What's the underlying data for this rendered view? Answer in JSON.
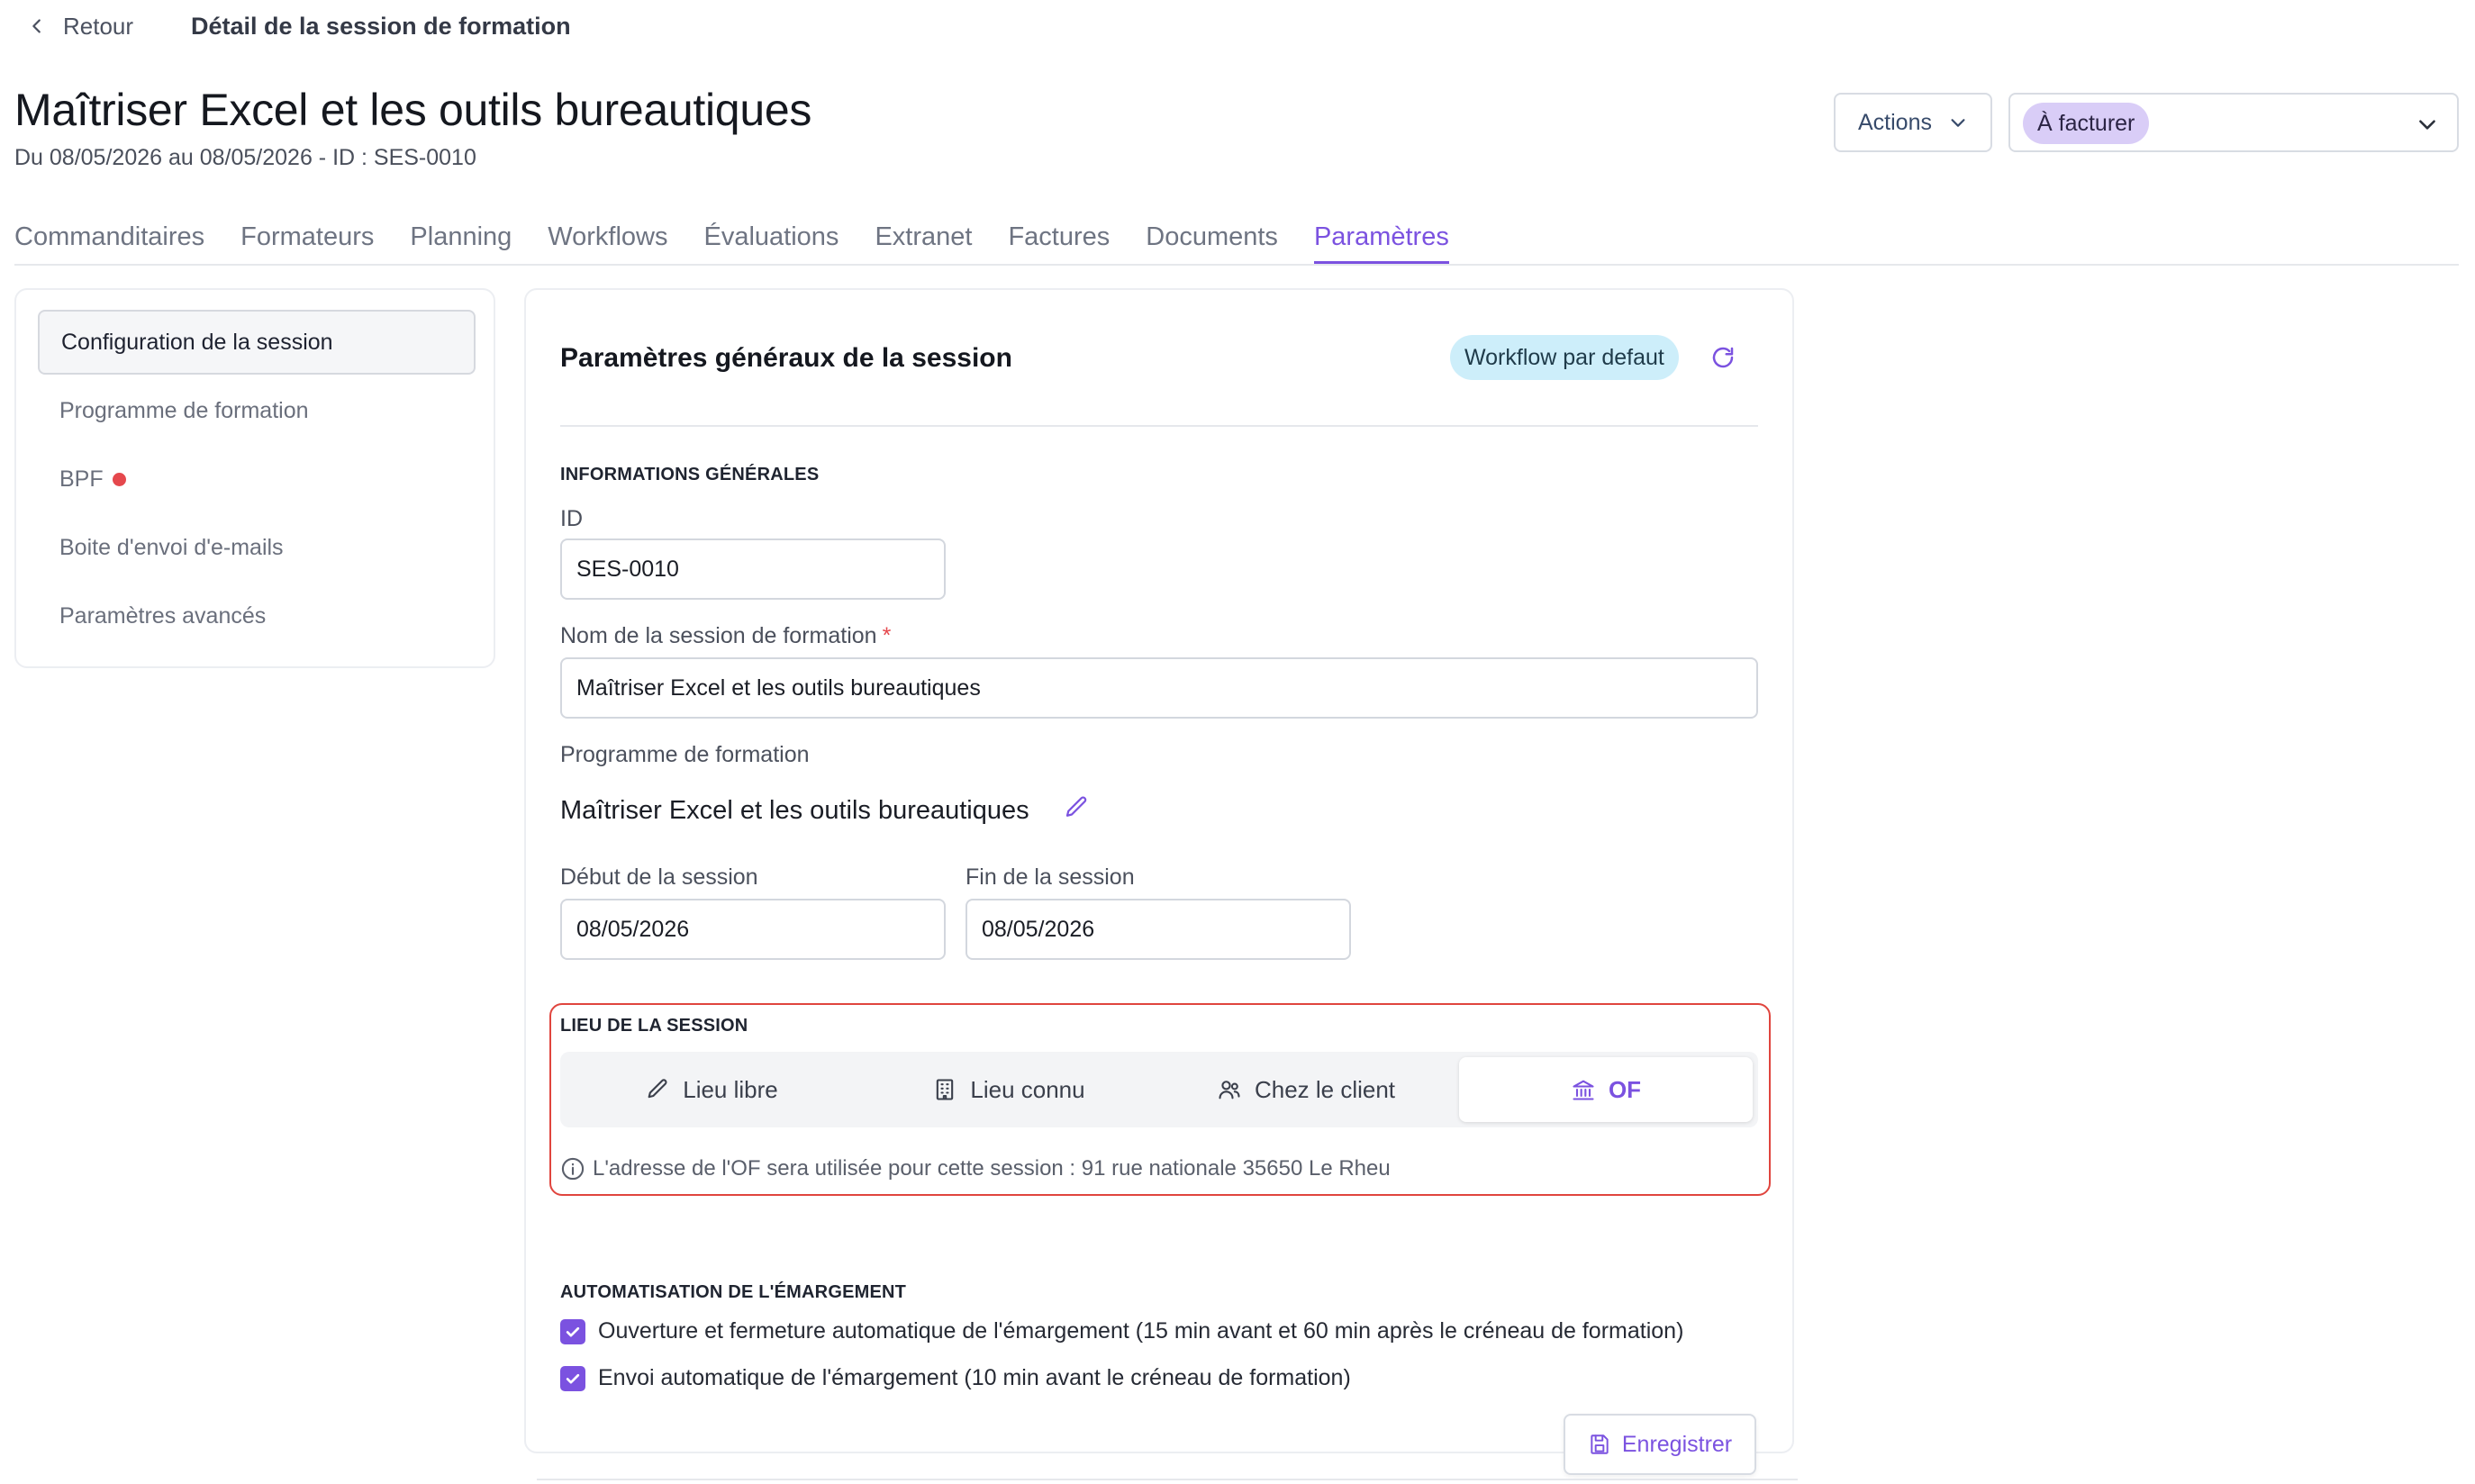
{
  "topbar": {
    "back_label": "Retour",
    "title": "Détail de la session de formation"
  },
  "header": {
    "title": "Maîtriser Excel et les outils bureautiques",
    "subtitle": "Du 08/05/2026 au 08/05/2026 - ID : SES-0010",
    "actions_label": "Actions",
    "status_value": "À facturer"
  },
  "tabs": [
    {
      "label": "Commanditaires"
    },
    {
      "label": "Formateurs"
    },
    {
      "label": "Planning"
    },
    {
      "label": "Workflows"
    },
    {
      "label": "Évaluations"
    },
    {
      "label": "Extranet"
    },
    {
      "label": "Factures"
    },
    {
      "label": "Documents"
    },
    {
      "label": "Paramètres",
      "active": true
    }
  ],
  "sidebar": {
    "items": [
      {
        "label": "Configuration de la session",
        "active": true
      },
      {
        "label": "Programme de formation"
      },
      {
        "label": "BPF",
        "alert": true
      },
      {
        "label": "Boite d'envoi d'e-mails"
      },
      {
        "label": "Paramètres avancés"
      }
    ]
  },
  "card": {
    "title": "Paramètres généraux de la session",
    "workflow_badge": "Workflow par defaut",
    "info_section": "INFORMATIONS GÉNÉRALES",
    "id_label": "ID",
    "id_value": "SES-0010",
    "name_label": "Nom de la session de formation",
    "name_required_mark": "*",
    "name_value": "Maîtriser Excel et les outils bureautiques",
    "program_label": "Programme de formation",
    "program_value": "Maîtriser Excel et les outils bureautiques",
    "start_label": "Début de la session",
    "start_value": "08/05/2026",
    "end_label": "Fin de la session",
    "end_value": "08/05/2026",
    "lieu_section": "LIEU DE LA SESSION",
    "lieu_options": [
      {
        "label": "Lieu libre",
        "icon": "pencil-icon"
      },
      {
        "label": "Lieu connu",
        "icon": "building-icon"
      },
      {
        "label": "Chez le client",
        "icon": "users-icon"
      },
      {
        "label": "OF",
        "icon": "institution-icon",
        "active": true
      }
    ],
    "lieu_info": "L'adresse de l'OF sera utilisée pour cette session : 91 rue nationale 35650 Le Rheu",
    "auto_section": "AUTOMATISATION DE L'ÉMARGEMENT",
    "auto_checks": [
      {
        "label": "Ouverture et fermeture automatique de l'émargement (15 min avant et 60 min après le créneau de formation)",
        "checked": true
      },
      {
        "label": "Envoi automatique de l'émargement (10 min avant le créneau de formation)",
        "checked": true
      }
    ],
    "save_label": "Enregistrer"
  },
  "colors": {
    "accent": "#7b52e0",
    "alert": "#e5484d",
    "status_pill": "#d9cdf7",
    "workflow_badge": "#cdeefa",
    "highlight_border": "#e0453e"
  }
}
